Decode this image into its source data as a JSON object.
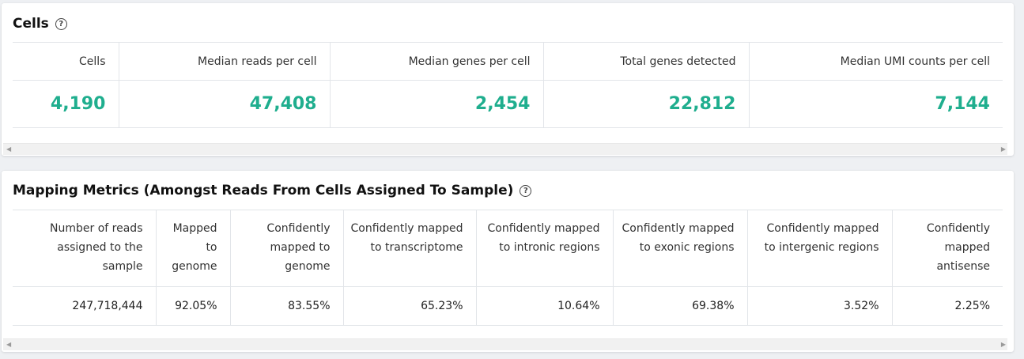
{
  "cells": {
    "title": "Cells",
    "help_glyph": "?",
    "columns": [
      "Cells",
      "Median reads per cell",
      "Median genes per cell",
      "Total genes detected",
      "Median UMI counts per cell"
    ],
    "values": [
      "4,190",
      "47,408",
      "2,454",
      "22,812",
      "7,144"
    ]
  },
  "mapping": {
    "title": "Mapping Metrics (Amongst Reads From Cells Assigned To Sample)",
    "help_glyph": "?",
    "columns": [
      "Number of reads assigned to the sample",
      "Mapped to genome",
      "Confidently mapped to genome",
      "Confidently mapped to transcriptome",
      "Confidently mapped to intronic regions",
      "Confidently mapped to exonic regions",
      "Confidently mapped to intergenic regions",
      "Confidently mapped antisense"
    ],
    "values": [
      "247,718,444",
      "92.05%",
      "83.55%",
      "65.23%",
      "10.64%",
      "69.38%",
      "3.52%",
      "2.25%"
    ]
  },
  "scrollbar": {
    "left_arrow": "◀",
    "right_arrow": "▶"
  },
  "colors": {
    "metric_value": "#1fae8e",
    "background": "#eef0f3"
  }
}
